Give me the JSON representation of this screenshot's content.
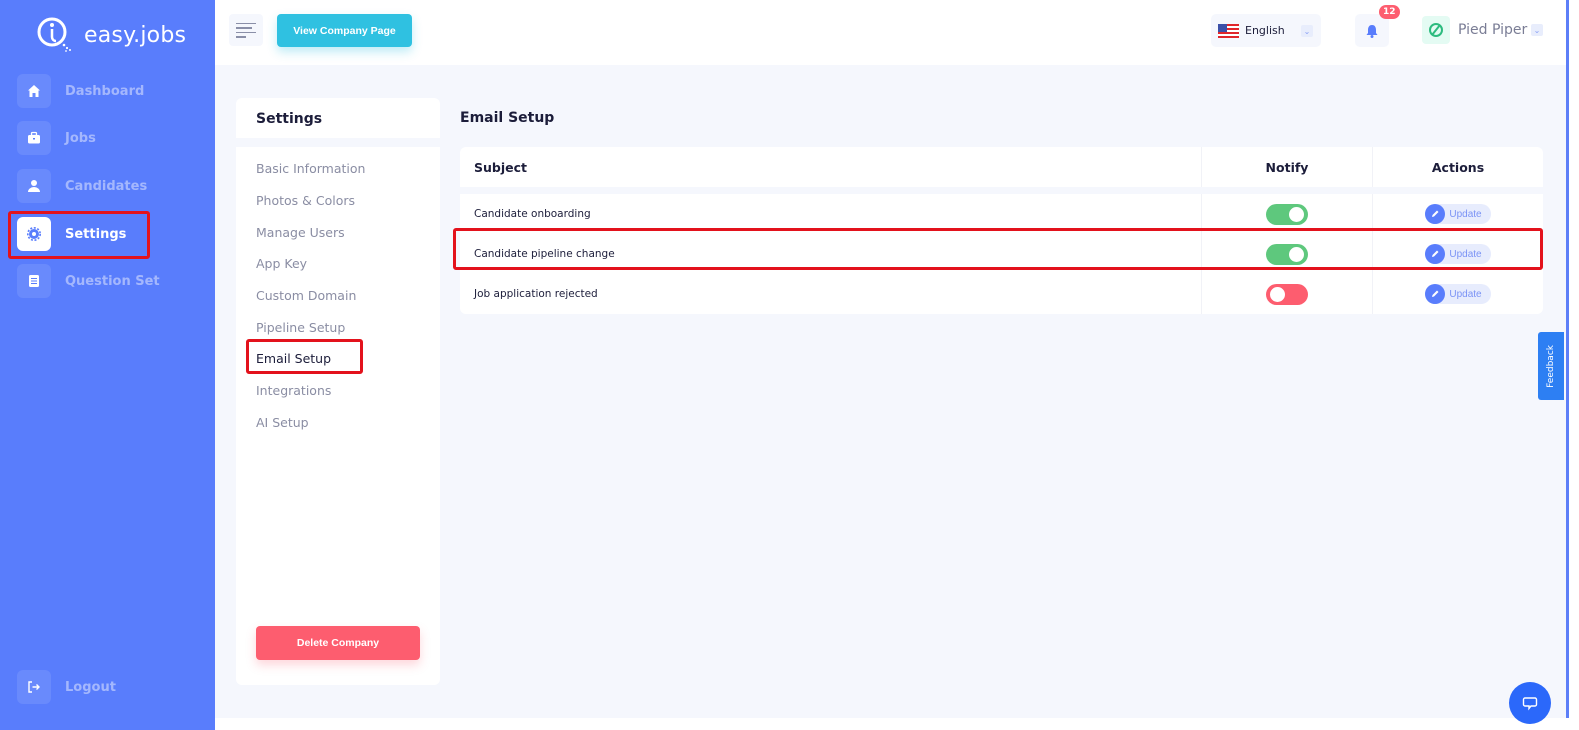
{
  "app": {
    "name": "easy.jobs"
  },
  "sidebar": {
    "items": [
      {
        "label": "Dashboard",
        "icon": "home-icon",
        "active": false
      },
      {
        "label": "Jobs",
        "icon": "briefcase-icon",
        "active": false
      },
      {
        "label": "Candidates",
        "icon": "user-icon",
        "active": false
      },
      {
        "label": "Settings",
        "icon": "gear-icon",
        "active": true
      },
      {
        "label": "Question Set",
        "icon": "document-icon",
        "active": false
      }
    ],
    "logout": "Logout"
  },
  "topbar": {
    "view_company_label": "View Company Page",
    "language": "English",
    "notification_count": "12",
    "company_name": "Pied Piper"
  },
  "settings": {
    "title": "Settings",
    "links": [
      {
        "label": "Basic Information",
        "active": false
      },
      {
        "label": "Photos & Colors",
        "active": false
      },
      {
        "label": "Manage Users",
        "active": false
      },
      {
        "label": "App Key",
        "active": false
      },
      {
        "label": "Custom Domain",
        "active": false
      },
      {
        "label": "Pipeline Setup",
        "active": false
      },
      {
        "label": "Email Setup",
        "active": true
      },
      {
        "label": "Integrations",
        "active": false
      },
      {
        "label": "AI Setup",
        "active": false
      }
    ],
    "delete_label": "Delete Company"
  },
  "email_setup": {
    "title": "Email Setup",
    "columns": [
      "Subject",
      "Notify",
      "Actions"
    ],
    "rows": [
      {
        "subject": "Candidate onboarding",
        "notify": true,
        "action": "Update"
      },
      {
        "subject": "Candidate pipeline change",
        "notify": true,
        "action": "Update"
      },
      {
        "subject": "Job application rejected",
        "notify": false,
        "action": "Update"
      }
    ]
  },
  "feedback_label": "Feedback",
  "colors": {
    "sidebar": "#597dfc",
    "accent_cyan": "#2fc1e1",
    "danger": "#fd5d6f",
    "success": "#5ec87d",
    "highlight": "#e3121c"
  }
}
